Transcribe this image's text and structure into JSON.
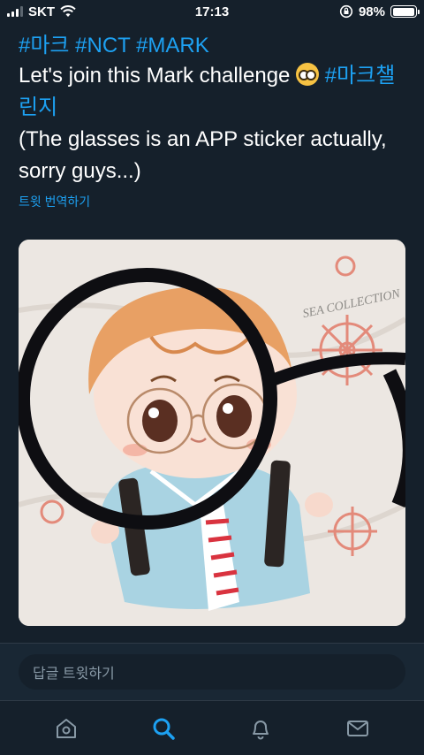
{
  "status": {
    "carrier": "SKT",
    "time": "17:13",
    "battery": "98%",
    "battery_level": 0.98
  },
  "tweet": {
    "hashtags": "#마크 #NCT #MARK",
    "line1_text": "Let's join this Mark challenge",
    "line1_emoji": "nerd-face-emoji",
    "line1_hash": "#마크챌",
    "line2_hash": "린지",
    "line3": "(The glasses is an APP sticker actually,",
    "line4": "sorry guys...)",
    "translate": "트윗 번역하기"
  },
  "media": {
    "watermark": "SEA COLLECTION"
  },
  "reply": {
    "placeholder": "답글 트윗하기"
  },
  "tabs": [
    {
      "name": "home",
      "active": false
    },
    {
      "name": "search",
      "active": true
    },
    {
      "name": "notifications",
      "active": false
    },
    {
      "name": "messages",
      "active": false
    }
  ],
  "colors": {
    "background": "#15202b",
    "accent": "#1da1f2",
    "muted": "#8899a6"
  }
}
